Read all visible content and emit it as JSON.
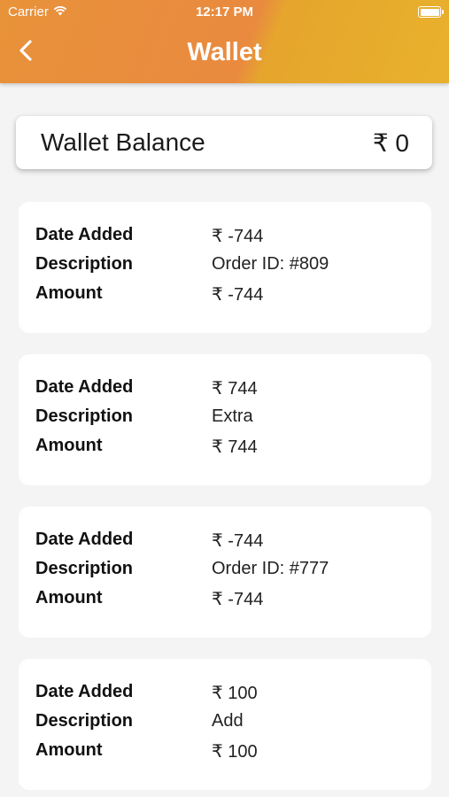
{
  "status_bar": {
    "carrier": "Carrier",
    "time": "12:17 PM"
  },
  "header": {
    "title": "Wallet",
    "back_icon": "chevron-left-icon"
  },
  "balance": {
    "label": "Wallet Balance",
    "value": "₹ 0"
  },
  "transactions": [
    {
      "date_label": "Date Added",
      "date_value": "₹ -744",
      "description_label": "Description",
      "description_value": "Order ID: #809",
      "amount_label": "Amount",
      "amount_value": "₹ -744"
    },
    {
      "date_label": "Date Added",
      "date_value": "₹ 744",
      "description_label": "Description",
      "description_value": "Extra",
      "amount_label": "Amount",
      "amount_value": "₹ 744"
    },
    {
      "date_label": "Date Added",
      "date_value": "₹ -744",
      "description_label": "Description",
      "description_value": "Order ID: #777",
      "amount_label": "Amount",
      "amount_value": "₹ -744"
    },
    {
      "date_label": "Date Added",
      "date_value": "₹ 100",
      "description_label": "Description",
      "description_value": "Add",
      "amount_label": "Amount",
      "amount_value": "₹ 100"
    }
  ],
  "colors": {
    "header_orange": "#e8923a",
    "header_yellow": "#e8b12c",
    "background": "#f4f4f4",
    "card": "#ffffff"
  }
}
